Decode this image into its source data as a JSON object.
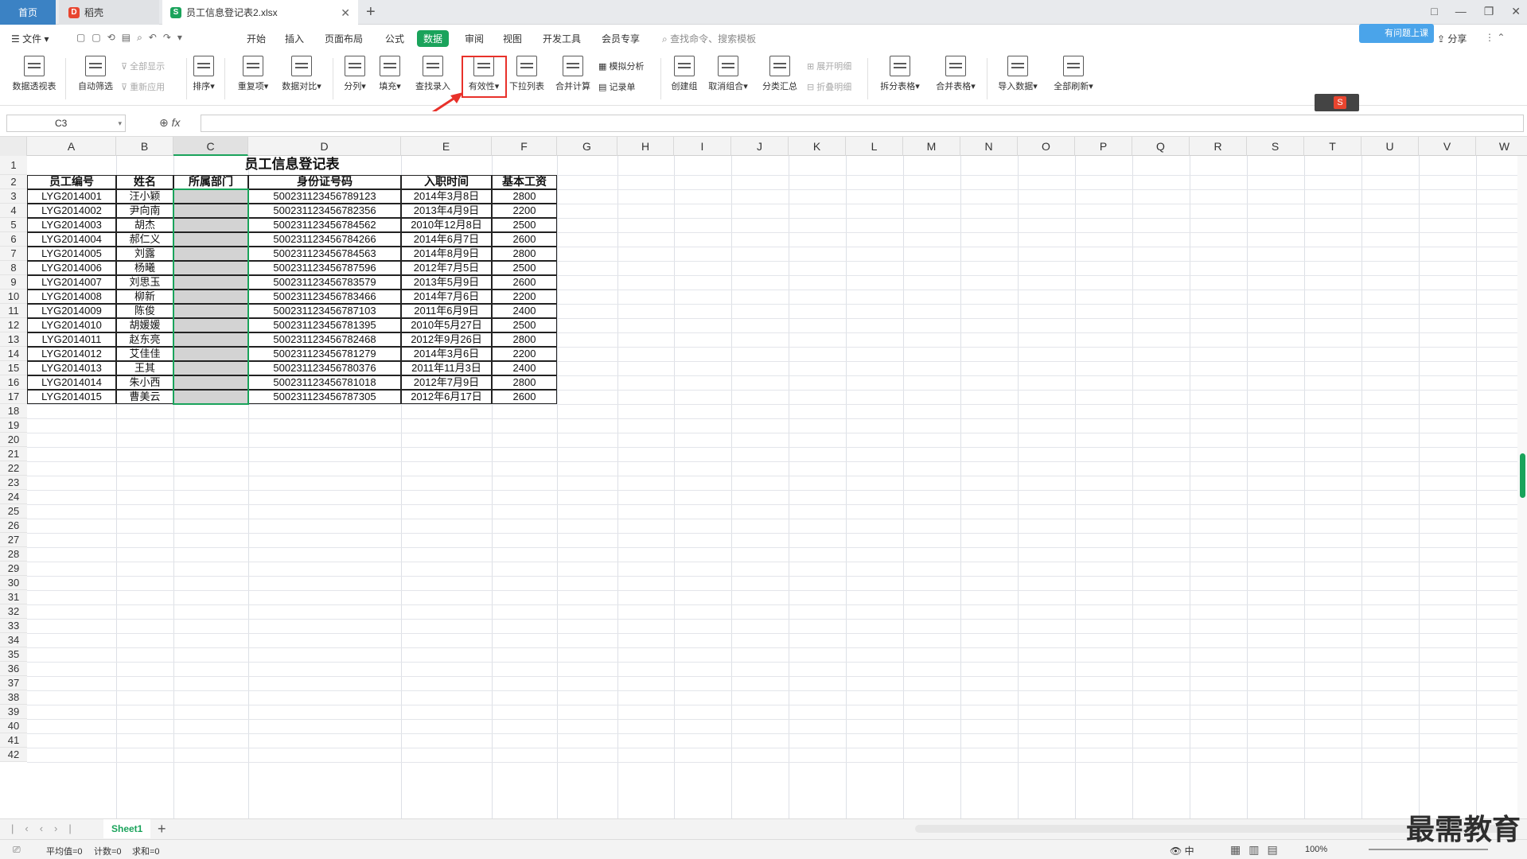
{
  "titlebar": {
    "home_tab": "首页",
    "wps_tab": "稻壳",
    "file_tab": "员工信息登记表2.xlsx",
    "new_tab_symbol": "+",
    "window_controls": [
      "□",
      "—",
      "❐",
      "✕"
    ]
  },
  "menubar": {
    "file": "文件",
    "items": [
      "开始",
      "插入",
      "页面布局",
      "公式",
      "数据",
      "审阅",
      "视图",
      "开发工具",
      "会员专享"
    ],
    "active": "数据",
    "search_placeholder": "查找命令、搜索模板",
    "share": "分享",
    "helper_chip": "有问题上课"
  },
  "ribbon": {
    "pivot": "数据透视表",
    "autofilter": "自动筛选",
    "show_all": "全部显示",
    "reapply": "重新应用",
    "sort": "排序",
    "duplicates": "重复项",
    "compare": "数据对比",
    "split": "分列",
    "fill": "填充",
    "lookup_entry": "查找录入",
    "validity": "有效性",
    "dropdown_list": "下拉列表",
    "consolidate": "合并计算",
    "what_if": "模拟分析",
    "record_form": "记录单",
    "create_group": "创建组",
    "ungroup": "取消组合",
    "subtotal": "分类汇总",
    "expand_detail": "展开明细",
    "collapse_detail": "折叠明细",
    "split_table": "拆分表格",
    "merge_table": "合并表格",
    "import_data": "导入数据",
    "refresh_all": "全部刷新"
  },
  "formulabar": {
    "namebox": "C3",
    "fx": "fx",
    "formula": ""
  },
  "columns": [
    "A",
    "B",
    "C",
    "D",
    "E",
    "F",
    "G",
    "H",
    "I",
    "J",
    "K",
    "L",
    "M",
    "N",
    "O",
    "P",
    "Q",
    "R",
    "S",
    "T",
    "U",
    "V",
    "W"
  ],
  "rows": [
    "1",
    "2",
    "3",
    "4",
    "5",
    "6",
    "7",
    "8",
    "9",
    "10",
    "11",
    "12",
    "13",
    "14",
    "15",
    "16",
    "17",
    "18",
    "19",
    "20",
    "21",
    "22",
    "23",
    "24",
    "25",
    "26",
    "27",
    "28",
    "29",
    "30",
    "31",
    "32",
    "33",
    "34",
    "35",
    "36",
    "37",
    "38",
    "39",
    "40",
    "41",
    "42"
  ],
  "sheet": {
    "title": "员工信息登记表",
    "headers": [
      "员工编号",
      "姓名",
      "所属部门",
      "身份证号码",
      "入职时间",
      "基本工资"
    ],
    "records": [
      [
        "LYG2014001",
        "汪小颖",
        "",
        "500231123456789123",
        "2014年3月8日",
        "2800"
      ],
      [
        "LYG2014002",
        "尹向南",
        "",
        "500231123456782356",
        "2013年4月9日",
        "2200"
      ],
      [
        "LYG2014003",
        "胡杰",
        "",
        "500231123456784562",
        "2010年12月8日",
        "2500"
      ],
      [
        "LYG2014004",
        "郝仁义",
        "",
        "500231123456784266",
        "2014年6月7日",
        "2600"
      ],
      [
        "LYG2014005",
        "刘露",
        "",
        "500231123456784563",
        "2014年8月9日",
        "2800"
      ],
      [
        "LYG2014006",
        "杨曦",
        "",
        "500231123456787596",
        "2012年7月5日",
        "2500"
      ],
      [
        "LYG2014007",
        "刘思玉",
        "",
        "500231123456783579",
        "2013年5月9日",
        "2600"
      ],
      [
        "LYG2014008",
        "柳新",
        "",
        "500231123456783466",
        "2014年7月6日",
        "2200"
      ],
      [
        "LYG2014009",
        "陈俊",
        "",
        "500231123456787103",
        "2011年6月9日",
        "2400"
      ],
      [
        "LYG2014010",
        "胡媛媛",
        "",
        "500231123456781395",
        "2010年5月27日",
        "2500"
      ],
      [
        "LYG2014011",
        "赵东亮",
        "",
        "500231123456782468",
        "2012年9月26日",
        "2800"
      ],
      [
        "LYG2014012",
        "艾佳佳",
        "",
        "500231123456781279",
        "2014年3月6日",
        "2200"
      ],
      [
        "LYG2014013",
        "王其",
        "",
        "500231123456780376",
        "2011年11月3日",
        "2400"
      ],
      [
        "LYG2014014",
        "朱小西",
        "",
        "500231123456781018",
        "2012年7月9日",
        "2800"
      ],
      [
        "LYG2014015",
        "曹美云",
        "",
        "500231123456787305",
        "2012年6月17日",
        "2600"
      ]
    ]
  },
  "sheetbar": {
    "sheet_name": "Sheet1",
    "add": "+"
  },
  "statusbar": {
    "average": "平均值=0",
    "count": "计数=0",
    "sum": "求和=0",
    "zoom": "100%",
    "input_mode": "中"
  },
  "watermark": "最需教育",
  "colors": {
    "accent_green": "#1aa35b",
    "highlight_red": "#e8312a",
    "home_tab_blue": "#3b82c4"
  }
}
